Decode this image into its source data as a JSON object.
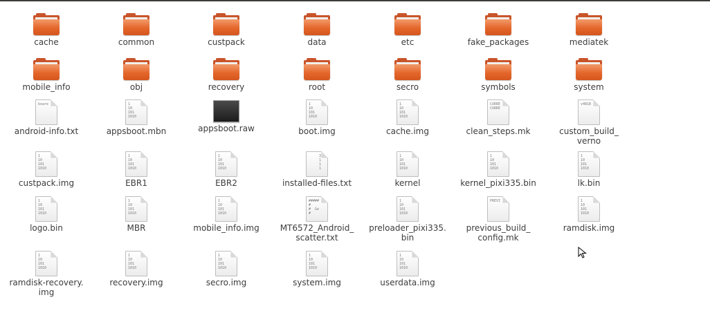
{
  "files": [
    {
      "name": "cache",
      "type": "folder"
    },
    {
      "name": "common",
      "type": "folder"
    },
    {
      "name": "custpack",
      "type": "folder"
    },
    {
      "name": "data",
      "type": "folder"
    },
    {
      "name": "etc",
      "type": "folder"
    },
    {
      "name": "fake_packages",
      "type": "folder"
    },
    {
      "name": "mediatek",
      "type": "folder"
    },
    {
      "name": "mobile_info",
      "type": "folder"
    },
    {
      "name": "obj",
      "type": "folder"
    },
    {
      "name": "recovery",
      "type": "folder"
    },
    {
      "name": "root",
      "type": "folder"
    },
    {
      "name": "secro",
      "type": "folder"
    },
    {
      "name": "symbols",
      "type": "folder"
    },
    {
      "name": "system",
      "type": "folder"
    },
    {
      "name": "android-info.txt",
      "type": "text",
      "preview": "boare"
    },
    {
      "name": "appsboot.mbn",
      "type": "binary",
      "preview": "1\n10\n101\n1010"
    },
    {
      "name": "appsboot.raw",
      "type": "image"
    },
    {
      "name": "boot.img",
      "type": "binary",
      "preview": "1\n10\n101\n1010"
    },
    {
      "name": "cache.img",
      "type": "binary",
      "preview": "1\n10\n101\n1010"
    },
    {
      "name": "clean_steps.mk",
      "type": "text",
      "preview": "CURRE\nCURRE"
    },
    {
      "name": "custom_build_\nverno",
      "type": "text",
      "preview": "v4B1B"
    },
    {
      "name": "custpack.img",
      "type": "binary",
      "preview": "1\n10\n101\n1010"
    },
    {
      "name": "EBR1",
      "type": "binary",
      "preview": "1\n10\n101\n1010"
    },
    {
      "name": "EBR2",
      "type": "binary",
      "preview": "1\n10\n101\n1010"
    },
    {
      "name": "installed-files.txt",
      "type": "text",
      "preview": "     3\n     1\n     1\n     1"
    },
    {
      "name": "kernel",
      "type": "binary",
      "preview": "1\n10\n101\n1010"
    },
    {
      "name": "kernel_pixi335.bin",
      "type": "binary",
      "preview": "1\n10\n101\n1010"
    },
    {
      "name": "lk.bin",
      "type": "binary",
      "preview": "1\n10\n101\n1010"
    },
    {
      "name": "logo.bin",
      "type": "binary",
      "preview": "1\n10\n101\n1010"
    },
    {
      "name": "MBR",
      "type": "binary",
      "preview": "1\n10\n101\n1010"
    },
    {
      "name": "mobile_info.img",
      "type": "binary",
      "preview": "1\n10\n101\n1010"
    },
    {
      "name": "MT6572_Android_\nscatter.txt",
      "type": "text",
      "preview": "#####\n#\n#  Ge\n#"
    },
    {
      "name": "preloader_pixi335.\nbin",
      "type": "binary",
      "preview": "1\n10\n101\n1010"
    },
    {
      "name": "previous_build_\nconfig.mk",
      "type": "text",
      "preview": "PREVI"
    },
    {
      "name": "ramdisk.img",
      "type": "binary",
      "preview": "1\n10\n101\n1010"
    },
    {
      "name": "ramdisk-recovery.\nimg",
      "type": "binary",
      "preview": "1\n10\n101\n1010"
    },
    {
      "name": "recovery.img",
      "type": "binary",
      "preview": "1\n10\n101\n1010"
    },
    {
      "name": "secro.img",
      "type": "binary",
      "preview": "1\n10\n101\n1010"
    },
    {
      "name": "system.img",
      "type": "binary",
      "preview": "1\n10\n101\n1010"
    },
    {
      "name": "userdata.img",
      "type": "binary",
      "preview": "1\n10\n101\n1010"
    }
  ],
  "colors": {
    "folder": "#e4662b",
    "label": "#3c3c3c"
  }
}
